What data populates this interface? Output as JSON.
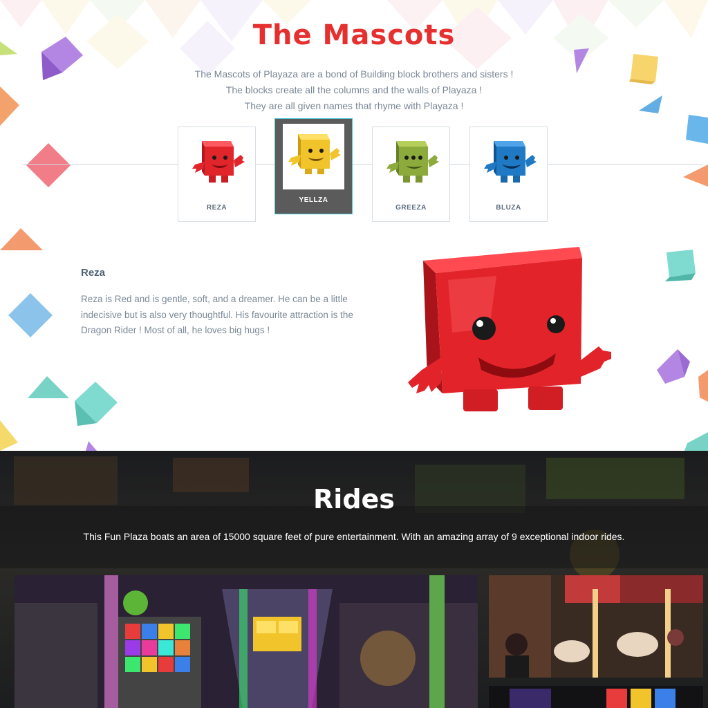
{
  "mascots_section": {
    "title": "The Mascots",
    "intro_lines": [
      "The Mascots of Playaza are a bond of Building block brothers and sisters !",
      "The blocks create all the columns and the walls of Playaza !",
      "They are all given names that rhyme with Playaza !"
    ],
    "cards": [
      {
        "name": "REZA",
        "color": "#e0252b",
        "eyes": 2,
        "active": false
      },
      {
        "name": "YELLZA",
        "color": "#f2c42c",
        "eyes": 2,
        "active": true
      },
      {
        "name": "GREEZA",
        "color": "#8dab3c",
        "eyes": 3,
        "active": false
      },
      {
        "name": "BLUZA",
        "color": "#1f79c4",
        "eyes": 2,
        "active": false
      }
    ],
    "detail": {
      "name": "Reza",
      "description": "Reza is Red and is gentle, soft, and a dreamer. He can be a little indecisive but is also very thoughtful. His favourite attraction is the Dragon Rider ! Most of all, he loves big hugs !"
    }
  },
  "rides_section": {
    "title": "Rides",
    "description": "This Fun Plaza boats an area of 15000 square feet of pure entertainment. With an amazing array of 9 exceptional indoor rides."
  },
  "colors": {
    "title_red": "#e5302f",
    "text_gray": "#7b8896",
    "active_border": "#4ec6d6"
  }
}
